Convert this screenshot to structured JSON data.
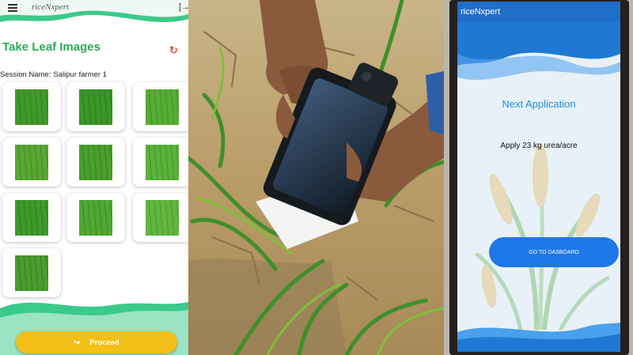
{
  "capture_screen": {
    "app_name": "riceNxpert",
    "title": "Take Leaf Images",
    "session_label": "Session Name:",
    "session_value": "Salipur farmer 1",
    "thumbnail_count": 10,
    "proceed_icon": "↪",
    "proceed_label": "Proceed",
    "icons": {
      "menu": "hamburger-menu-icon",
      "exit": "logout-icon",
      "refresh": "refresh-icon"
    },
    "colors": {
      "title": "#2eaa55",
      "proceed_button": "#f2c018",
      "wave_green": "#3cc98a",
      "refresh": "#e84b3c"
    }
  },
  "recommendation_screen": {
    "app_name": "riceNxpert",
    "heading": "Next Application",
    "recommendation": "Apply 23 kg urea/acre",
    "dashboard_button": "GO TO DASBOARD",
    "colors": {
      "app_bar": "#1f6ec8",
      "button": "#1e78e6",
      "heading": "#1f8ed6"
    }
  }
}
